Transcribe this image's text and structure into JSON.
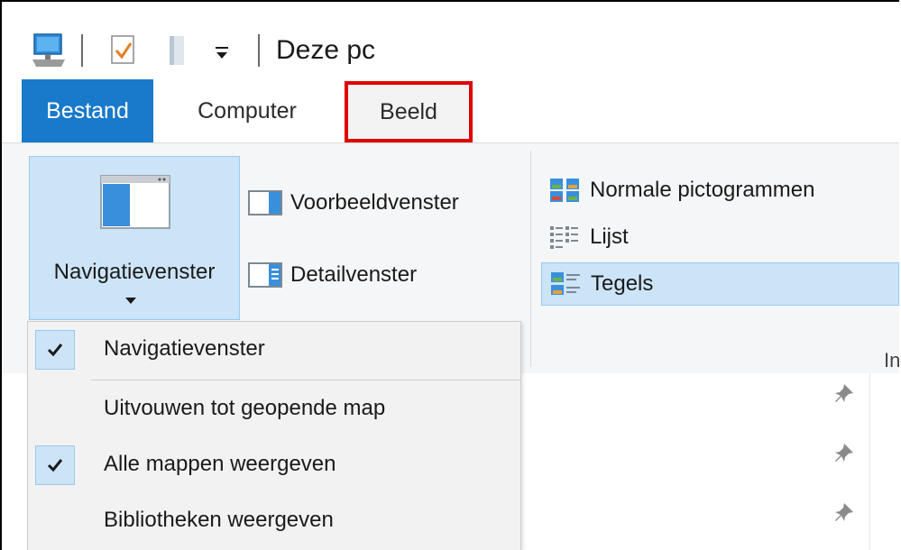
{
  "window": {
    "title": "Deze pc"
  },
  "quick_access": {
    "icons": [
      "computer-icon",
      "properties-icon",
      "new-folder-icon",
      "customize-qat-icon"
    ]
  },
  "tabs": [
    {
      "label": "Bestand",
      "active": false,
      "highlighted": false
    },
    {
      "label": "Computer",
      "active": false,
      "highlighted": false
    },
    {
      "label": "Beeld",
      "active": true,
      "highlighted": true
    }
  ],
  "ribbon": {
    "panes": {
      "navigation_pane_label": "Navigatievenster",
      "preview_pane_label": "Voorbeeldvenster",
      "details_pane_label": "Detailvenster"
    },
    "layout": {
      "items": [
        {
          "label": "Normale pictogrammen",
          "selected": false
        },
        {
          "label": "Lijst",
          "selected": false
        },
        {
          "label": "Tegels",
          "selected": true
        }
      ],
      "group_label_partial": "In"
    }
  },
  "nav_menu": {
    "items": [
      {
        "label": "Navigatievenster",
        "checked": true
      },
      {
        "label": "Uitvouwen tot geopende map",
        "checked": false
      },
      {
        "label": "Alle mappen weergeven",
        "checked": true
      },
      {
        "label": "Bibliotheken weergeven",
        "checked": false
      }
    ]
  },
  "colors": {
    "accent": "#1979ca",
    "selection": "#cce4f7",
    "selection_border": "#99c9ef",
    "highlight_box": "#e00000"
  }
}
